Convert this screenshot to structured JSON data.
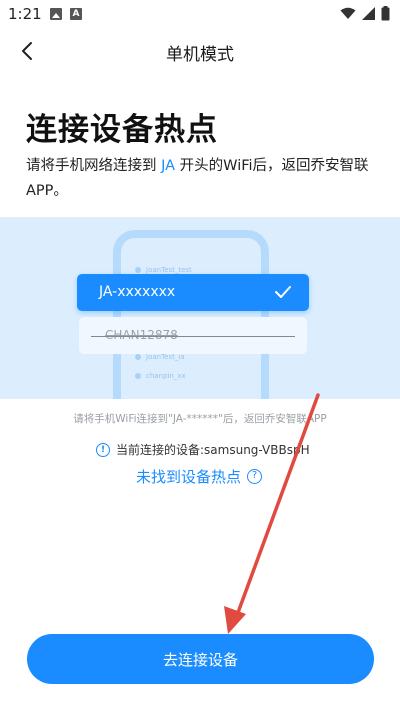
{
  "status_bar": {
    "time": "1:21"
  },
  "header": {
    "title": "单机模式"
  },
  "main": {
    "title": "连接设备热点",
    "instruction_prefix": "请将手机网络连接到 ",
    "instruction_highlight": "JA",
    "instruction_suffix": " 开头的WiFi后，返回乔安智联APP。"
  },
  "illustration": {
    "selected_wifi": "JA-xxxxxxx",
    "other_wifi": "CHAN12878",
    "background_rows": [
      "JoanTest_test",
      "JoanTest_ia",
      "chanpin_xx"
    ]
  },
  "hint": "请将手机WiFi连接到\"JA-******\"后，返回乔安智联APP",
  "current_device": "当前连接的设备:samsung-VBBspH",
  "not_found_link": "未找到设备热点",
  "connect_button": "去连接设备",
  "colors": {
    "accent": "#1a8cff",
    "annotation_arrow": "#e04a3f"
  }
}
